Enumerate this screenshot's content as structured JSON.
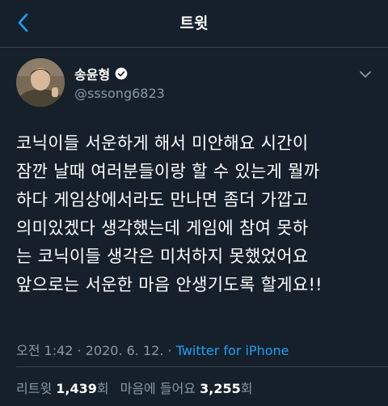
{
  "nav": {
    "title": "트윗",
    "back_icon": "chevron-left-icon",
    "accent": "#1da1f2"
  },
  "tweet": {
    "author": {
      "name": "송윤형",
      "handle": "@sssong6823",
      "verified_icon": "verified-badge-icon"
    },
    "menu_icon": "chevron-down-icon",
    "text": "코닉이들 서운하게 해서 미안해요  시간이\n잠깐 날때 여러분들이랑 할 수 있는게 뭘까\n하다 게임상에서라도 만나면 좀더 가깝고\n의미있겠다 생각했는데  게임에 참여 못하\n는 코닉이들 생각은 미처하지 못했었어요\n앞으로는 서운한 마음 안생기도록 할게요!!",
    "time": "오전 1:42",
    "separator": " · ",
    "date": "2020. 6. 12.",
    "source": "Twitter for iPhone",
    "stats": {
      "retweets_label": "리트윗",
      "retweets_count": "1,439",
      "retweets_unit": "회",
      "likes_label": "마음에 들어요",
      "likes_count": "3,255",
      "likes_unit": "회"
    }
  },
  "colors": {
    "background": "#15202b",
    "secondary_text": "#8899a6",
    "border": "#38444d"
  }
}
